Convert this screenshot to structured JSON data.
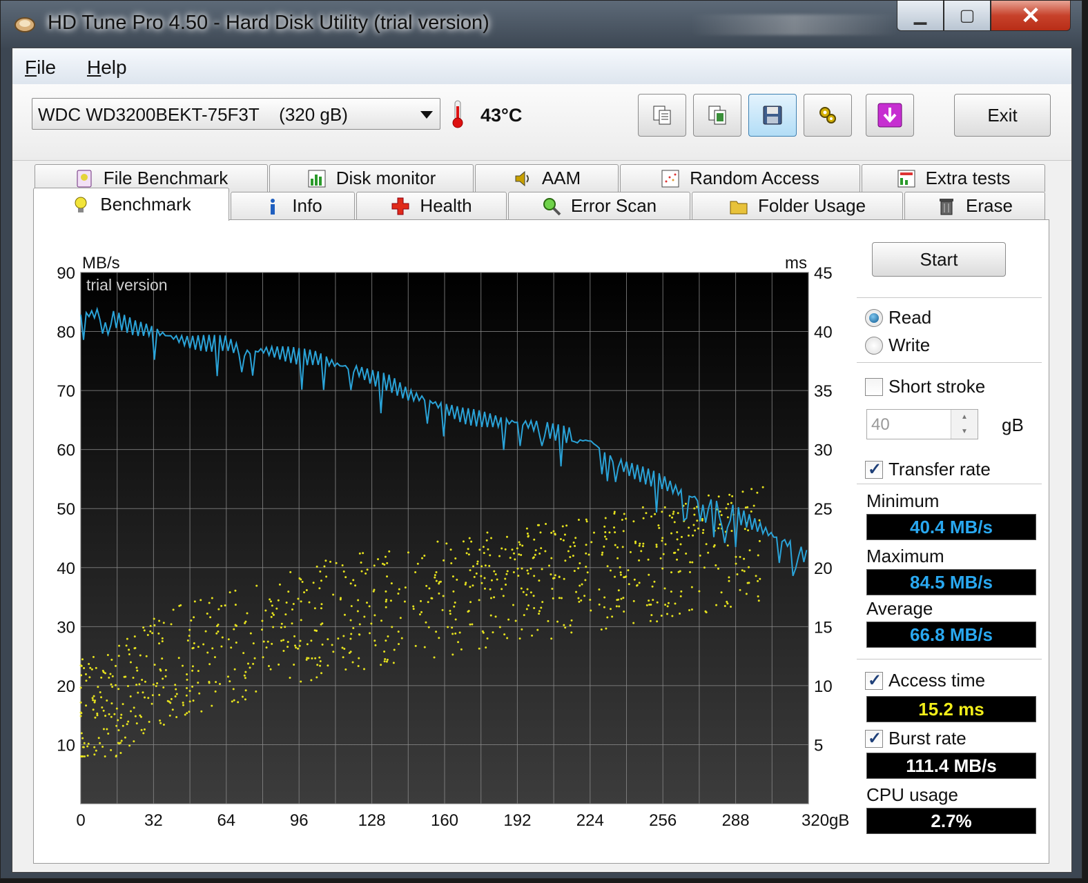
{
  "window": {
    "title": "HD Tune Pro 4.50 - Hard Disk Utility (trial version)",
    "controls": {
      "minimize": "▁",
      "maximize": "▢",
      "close": "✕"
    }
  },
  "menu": [
    {
      "label": "File",
      "mnemonic": "F",
      "rest": "ile"
    },
    {
      "label": "Help",
      "mnemonic": "H",
      "rest": "elp"
    }
  ],
  "toolbar": {
    "drive": "WDC WD3200BEKT-75F3T    (320 gB)",
    "temperature": "43°C",
    "buttons": [
      "copy-text-icon",
      "copy-screenshot-icon",
      "save-icon",
      "options-icon",
      "download-icon"
    ],
    "active_button": 2,
    "exit_label": "Exit"
  },
  "tabs_top": [
    {
      "label": "File Benchmark",
      "icon": "file-benchmark-icon"
    },
    {
      "label": "Disk monitor",
      "icon": "disk-monitor-icon"
    },
    {
      "label": "AAM",
      "icon": "aam-speaker-icon"
    },
    {
      "label": "Random Access",
      "icon": "random-access-icon"
    },
    {
      "label": "Extra tests",
      "icon": "extra-tests-icon"
    }
  ],
  "tabs_bottom": [
    {
      "label": "Benchmark",
      "icon": "benchmark-bulb-icon",
      "selected": true
    },
    {
      "label": "Info",
      "icon": "info-icon"
    },
    {
      "label": "Health",
      "icon": "health-cross-icon"
    },
    {
      "label": "Error Scan",
      "icon": "error-scan-magnifier-icon"
    },
    {
      "label": "Folder Usage",
      "icon": "folder-icon"
    },
    {
      "label": "Erase",
      "icon": "trash-icon"
    }
  ],
  "side": {
    "start_label": "Start",
    "read_label": "Read",
    "write_label": "Write",
    "mode": "Read",
    "short_stroke_label": "Short stroke",
    "short_stroke_checked": false,
    "short_stroke_value": "40",
    "short_stroke_unit": "gB",
    "transfer_rate_label": "Transfer rate",
    "transfer_rate_checked": true,
    "minimum_label": "Minimum",
    "minimum_value": "40.4 MB/s",
    "maximum_label": "Maximum",
    "maximum_value": "84.5 MB/s",
    "average_label": "Average",
    "average_value": "66.8 MB/s",
    "access_time_label": "Access time",
    "access_time_checked": true,
    "access_time_value": "15.2 ms",
    "burst_rate_label": "Burst rate",
    "burst_rate_checked": true,
    "burst_rate_value": "111.4 MB/s",
    "cpu_label": "CPU usage",
    "cpu_value": "2.7%"
  },
  "colors": {
    "transfer_line": "#2aa3d8",
    "access_dots": "#e6e21e",
    "value_blue": "#29a8f0",
    "value_yellow": "#f2ee1a",
    "value_white": "#ffffff"
  },
  "chart_data": {
    "type": "line",
    "watermark": "trial version",
    "ylabel_left": "MB/s",
    "ylabel_right": "ms",
    "x_unit": "gB",
    "x_ticks": [
      "0",
      "32",
      "64",
      "96",
      "128",
      "160",
      "192",
      "224",
      "256",
      "288",
      "320gB"
    ],
    "y_left_ticks": [
      "90",
      "80",
      "70",
      "60",
      "50",
      "40",
      "30",
      "20",
      "10"
    ],
    "y_right_ticks": [
      "45",
      "40",
      "35",
      "30",
      "25",
      "20",
      "15",
      "10",
      "5"
    ],
    "xlim": [
      0,
      320
    ],
    "ylim_left": [
      0,
      90
    ],
    "ylim_right": [
      0,
      45
    ],
    "grid": true,
    "series": [
      {
        "name": "Transfer rate",
        "axis": "left",
        "x": [
          0,
          8,
          16,
          24,
          32,
          40,
          48,
          56,
          64,
          72,
          80,
          88,
          96,
          104,
          112,
          120,
          128,
          136,
          144,
          152,
          160,
          168,
          176,
          184,
          192,
          200,
          208,
          216,
          224,
          232,
          240,
          248,
          256,
          264,
          272,
          280,
          288,
          296,
          304,
          312,
          320
        ],
        "values": [
          82,
          82,
          81,
          80,
          80,
          79.5,
          79,
          79,
          79,
          77,
          77,
          76,
          75,
          74.5,
          73.5,
          73,
          72,
          71.5,
          70,
          69.5,
          68,
          66.5,
          65.5,
          64.5,
          64,
          63,
          62,
          61.5,
          61.5,
          59,
          57.5,
          56.5,
          55.5,
          53.5,
          52,
          50,
          48.5,
          46.5,
          44.5,
          43,
          41
        ]
      },
      {
        "name": "Access time",
        "axis": "right",
        "type": "scatter",
        "x": [
          0,
          16,
          32,
          48,
          64,
          80,
          96,
          112,
          128,
          144,
          160,
          176,
          192,
          208,
          224,
          240,
          256,
          272,
          288,
          304
        ],
        "values": [
          7.5,
          9,
          11,
          12.5,
          13,
          14.5,
          15,
          16,
          16.5,
          17,
          17.5,
          18,
          18.5,
          19,
          19.5,
          20,
          20.5,
          21,
          21.5,
          22
        ]
      }
    ]
  }
}
